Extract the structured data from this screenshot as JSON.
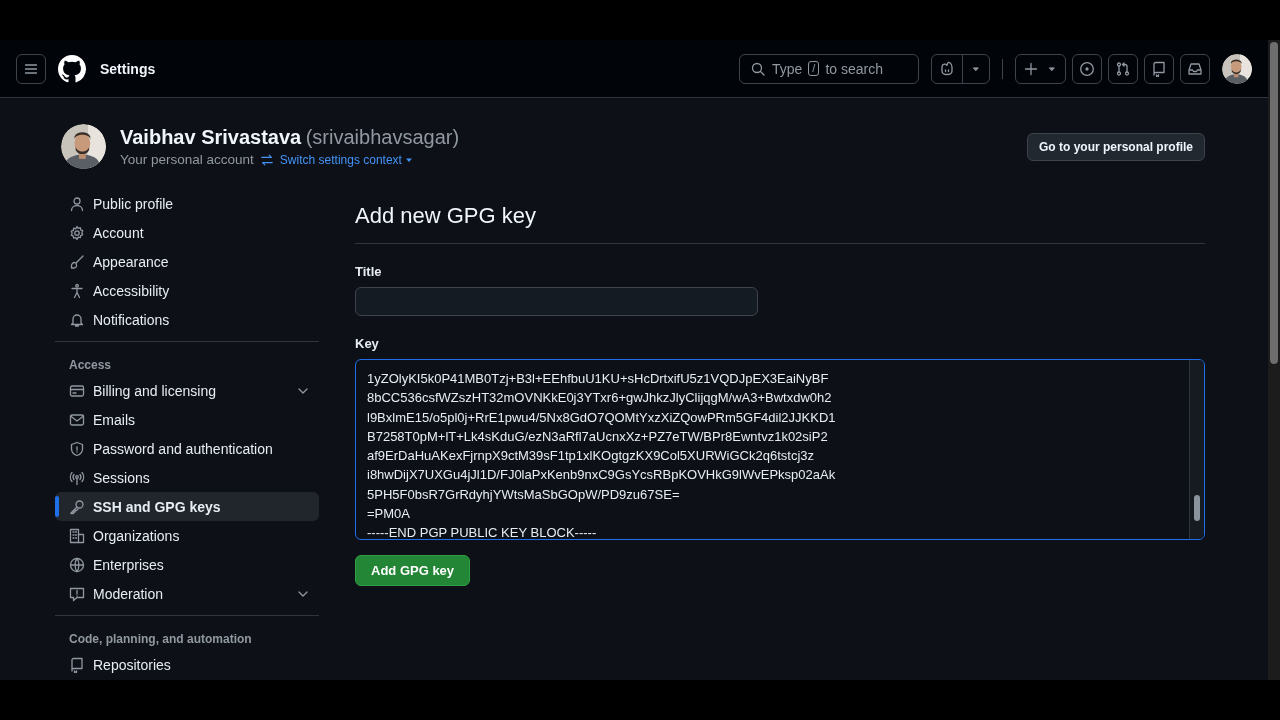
{
  "header": {
    "title": "Settings",
    "search": {
      "before": "Type",
      "key": "/",
      "after": "to search"
    }
  },
  "account": {
    "name": "Vaibhav Srivastava",
    "handle": "(srivaibhavsagar)",
    "subtitle": "Your personal account",
    "switch_link": "Switch settings context",
    "profile_button": "Go to your personal profile"
  },
  "sidebar": {
    "groups": [
      {
        "items": [
          {
            "label": "Public profile",
            "selected": false,
            "expandable": false
          },
          {
            "label": "Account",
            "selected": false,
            "expandable": false
          },
          {
            "label": "Appearance",
            "selected": false,
            "expandable": false
          },
          {
            "label": "Accessibility",
            "selected": false,
            "expandable": false
          },
          {
            "label": "Notifications",
            "selected": false,
            "expandable": false
          }
        ]
      },
      {
        "heading": "Access",
        "items": [
          {
            "label": "Billing and licensing",
            "selected": false,
            "expandable": true
          },
          {
            "label": "Emails",
            "selected": false,
            "expandable": false
          },
          {
            "label": "Password and authentication",
            "selected": false,
            "expandable": false
          },
          {
            "label": "Sessions",
            "selected": false,
            "expandable": false
          },
          {
            "label": "SSH and GPG keys",
            "selected": true,
            "expandable": false
          },
          {
            "label": "Organizations",
            "selected": false,
            "expandable": false
          },
          {
            "label": "Enterprises",
            "selected": false,
            "expandable": false
          },
          {
            "label": "Moderation",
            "selected": false,
            "expandable": true
          }
        ]
      },
      {
        "heading": "Code, planning, and automation",
        "items": [
          {
            "label": "Repositories",
            "selected": false,
            "expandable": false
          }
        ]
      }
    ]
  },
  "form": {
    "heading": "Add new GPG key",
    "title_label": "Title",
    "key_label": "Key",
    "key_lines": [
      "1yZOlyKI5k0P41MB0Tzj+B3l+EEhfbuU1KU+sHcDrtxifU5z1VQDJpEX3EaiNyBF",
      "8bCC536csfWZszHT32mOVNKkE0j3YTxr6+gwJhkzJlyClijqgM/wA3+Bwtxdw0h2",
      "l9BxlmE15/o5pl0j+RrE1pwu4/5Nx8GdO7QOMtYxzXiZQowPRm5GF4dil2JJKKD1",
      "B7258T0pM+lT+Lk4sKduG/ezN3aRfl7aUcnxXz+PZ7eTW/BPr8Ewntvz1k02siP2",
      "af9ErDaHuAKexFjrnpX9ctM39sF1tp1xlKOgtgzKX9Col5XURWiGCk2q6tstcj3z",
      "i8hwDijX7UXGu4jJl1D/FJ0laPxKenb9nxC9GsYcsRBpKOVHkG9lWvEPksp02aAk",
      "5PH5F0bsR7GrRdyhjYWtsMaSbGOpW/PD9zu67SE=",
      "=PM0A",
      "-----END PGP PUBLIC KEY BLOCK-----"
    ],
    "submit": "Add GPG key"
  }
}
